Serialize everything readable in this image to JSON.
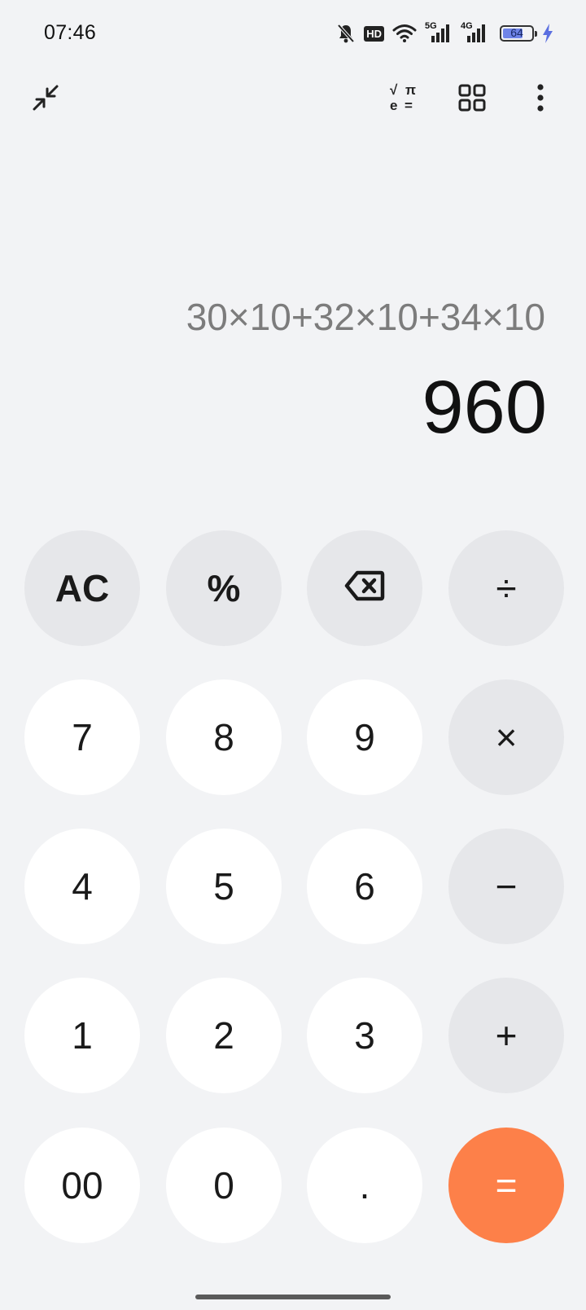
{
  "status": {
    "time": "07:46",
    "hd": "HD",
    "net1": "5G",
    "net2": "4G",
    "battery": "64",
    "icons": [
      "bell-muted-icon",
      "hd-icon",
      "wifi-icon",
      "signal-5g-icon",
      "signal-4g-icon",
      "battery-icon",
      "charging-bolt-icon"
    ]
  },
  "toolbar": {
    "icons": [
      "collapse-icon",
      "scientific-icon",
      "grid-icon",
      "more-vertical-icon"
    ],
    "sci_sqrt": "√",
    "sci_pi": "π",
    "sci_e": "e",
    "sci_eq": "="
  },
  "display": {
    "expression": "30×10+32×10+34×10",
    "result": "960"
  },
  "keys": {
    "ac": "AC",
    "percent": "%",
    "divide": "÷",
    "seven": "7",
    "eight": "8",
    "nine": "9",
    "multiply": "×",
    "four": "4",
    "five": "5",
    "six": "6",
    "minus": "−",
    "one": "1",
    "two": "2",
    "three": "3",
    "plus": "+",
    "double_zero": "00",
    "zero": "0",
    "decimal": ".",
    "equals": "="
  },
  "colors": {
    "background": "#f2f3f5",
    "key_number": "#ffffff",
    "key_operator": "#e6e7ea",
    "key_equals": "#fd8049"
  }
}
